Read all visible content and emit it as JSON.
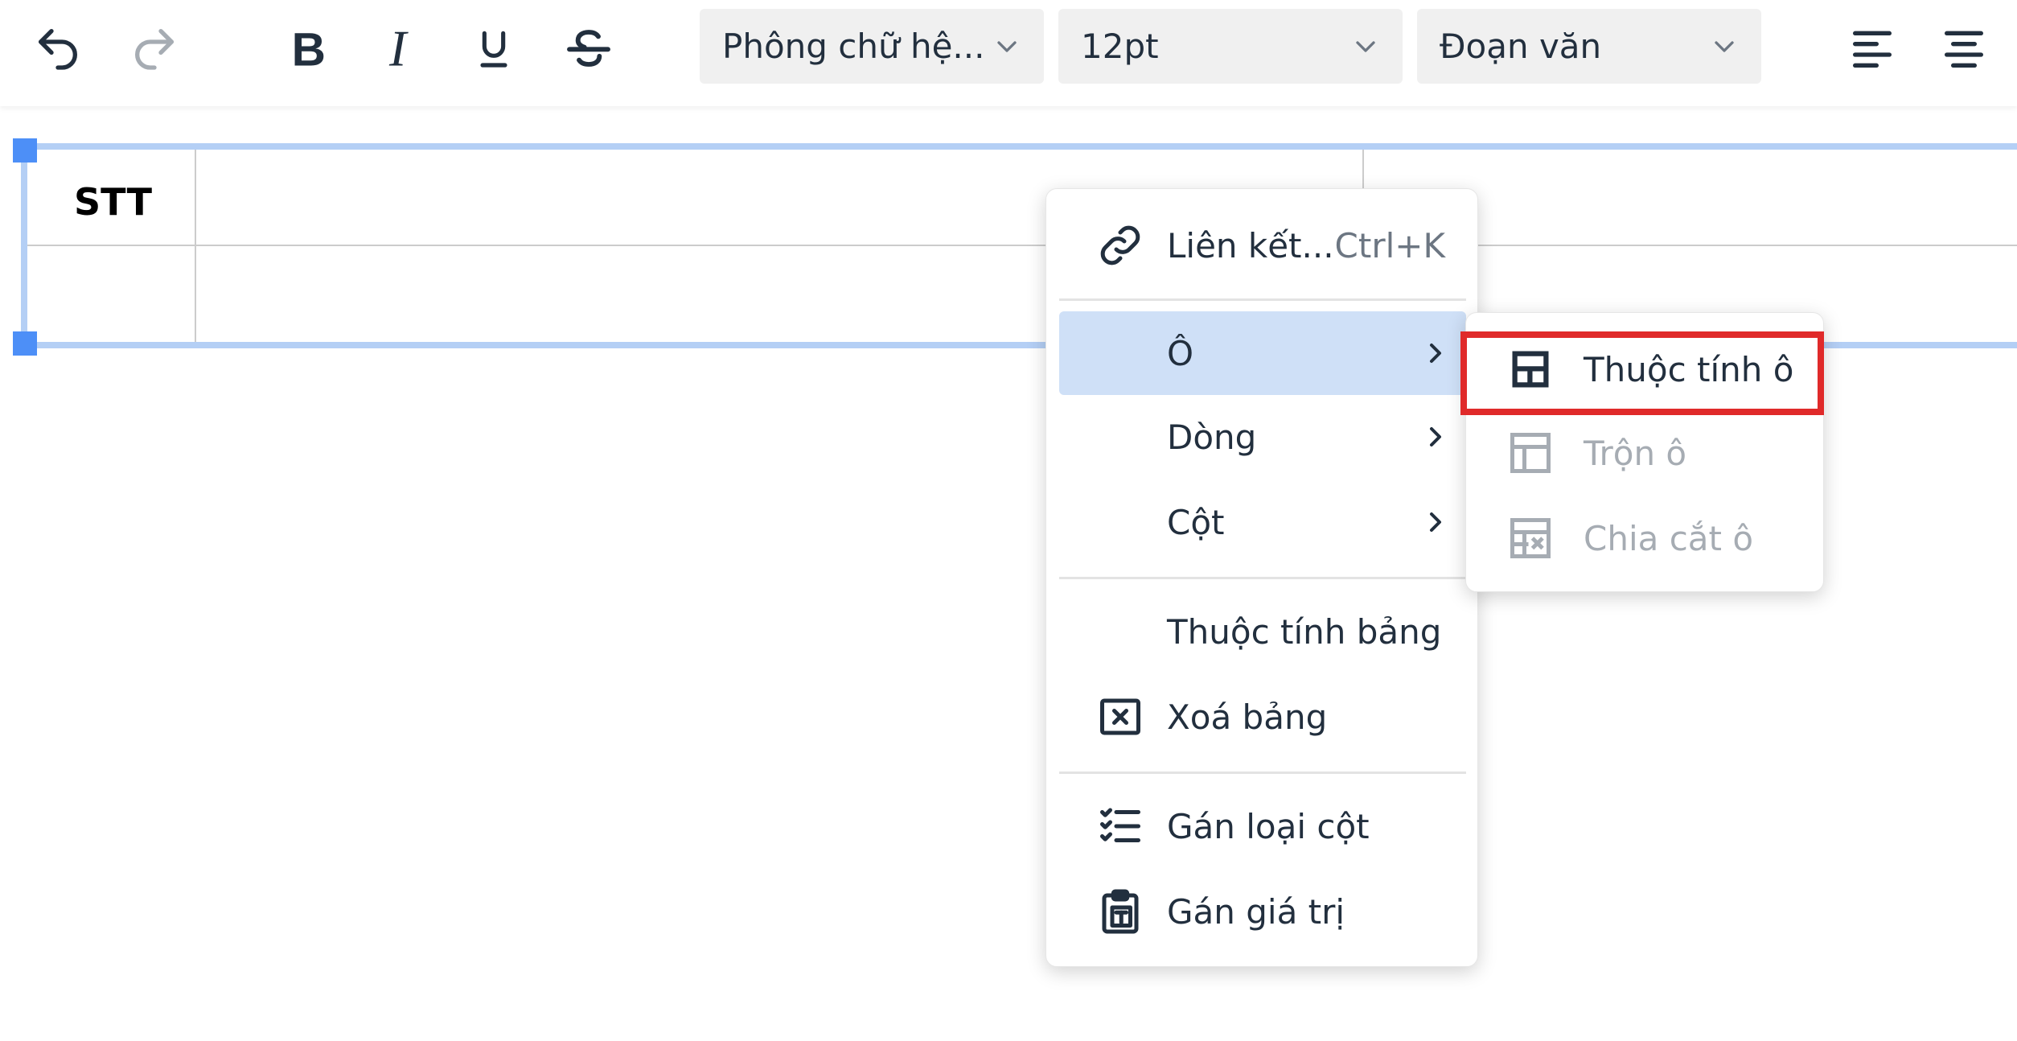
{
  "toolbar": {
    "font_family_value": "Phông chữ hệ...",
    "font_size_value": "12pt",
    "block_format_value": "Đoạn văn"
  },
  "table": {
    "header_first_cell": "STT"
  },
  "context_menu": {
    "link_label": "Liên kết...",
    "link_shortcut": "Ctrl+K",
    "cell_label": "Ô",
    "row_label": "Dòng",
    "column_label": "Cột",
    "table_props_label": "Thuộc tính bảng",
    "delete_table_label": "Xoá bảng",
    "assign_column_type_label": "Gán loại cột",
    "assign_value_label": "Gán giá trị"
  },
  "cell_submenu": {
    "cell_props_label": "Thuộc tính ô",
    "merge_cells_label": "Trộn ô",
    "split_cell_label": "Chia cắt ô"
  },
  "colors": {
    "menu_active_bg": "#cfe0f7",
    "table_selection": "#b4cff5",
    "handle": "#4d8ff7",
    "highlight": "#e02a2a",
    "disabled_text": "#a6acb3"
  }
}
